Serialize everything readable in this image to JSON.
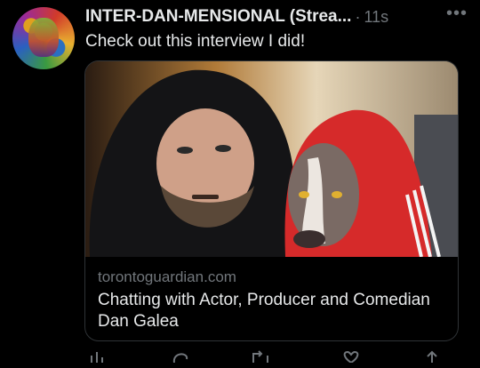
{
  "tweet": {
    "author_name": "INTER-DAN-MENSIONAL (Strea...",
    "separator": "·",
    "timestamp": "11s",
    "text": "Check out this interview I did!"
  },
  "card": {
    "domain": "torontoguardian.com",
    "title": "Chatting with Actor, Producer and Comedian Dan Galea",
    "image_description_icon": "photo-man-and-dog-in-hoodies"
  },
  "actions": {
    "icons": [
      "analytics-icon",
      "reply-icon",
      "retweet-icon",
      "like-icon",
      "share-icon"
    ]
  },
  "colors": {
    "background": "#000000",
    "text": "#e7e9ea",
    "muted": "#71767b",
    "border": "#2f3336",
    "hoodie_red": "#d62a2a"
  }
}
